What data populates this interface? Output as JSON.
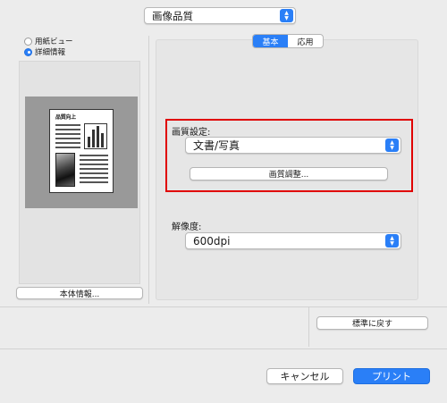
{
  "header": {
    "category_popup": "画像品質"
  },
  "left": {
    "view_options": [
      {
        "label": "用紙ビュー",
        "selected": false
      },
      {
        "label": "詳細情報",
        "selected": true
      }
    ],
    "preview_doc_title": "品質向上",
    "device_info_button": "本体情報..."
  },
  "tabs": [
    {
      "label": "基本",
      "selected": true
    },
    {
      "label": "応用",
      "selected": false
    }
  ],
  "quality": {
    "section_label": "画質設定:",
    "mode_value": "文書/写真",
    "adjust_button": "画質調整..."
  },
  "resolution": {
    "label": "解像度:",
    "value": "600dpi"
  },
  "restore_defaults_button": "標準に戻す",
  "footer": {
    "cancel_button": "キャンセル",
    "print_button": "プリント"
  },
  "colors": {
    "accent": "#2a7ff7",
    "highlight_border": "#e00000"
  }
}
